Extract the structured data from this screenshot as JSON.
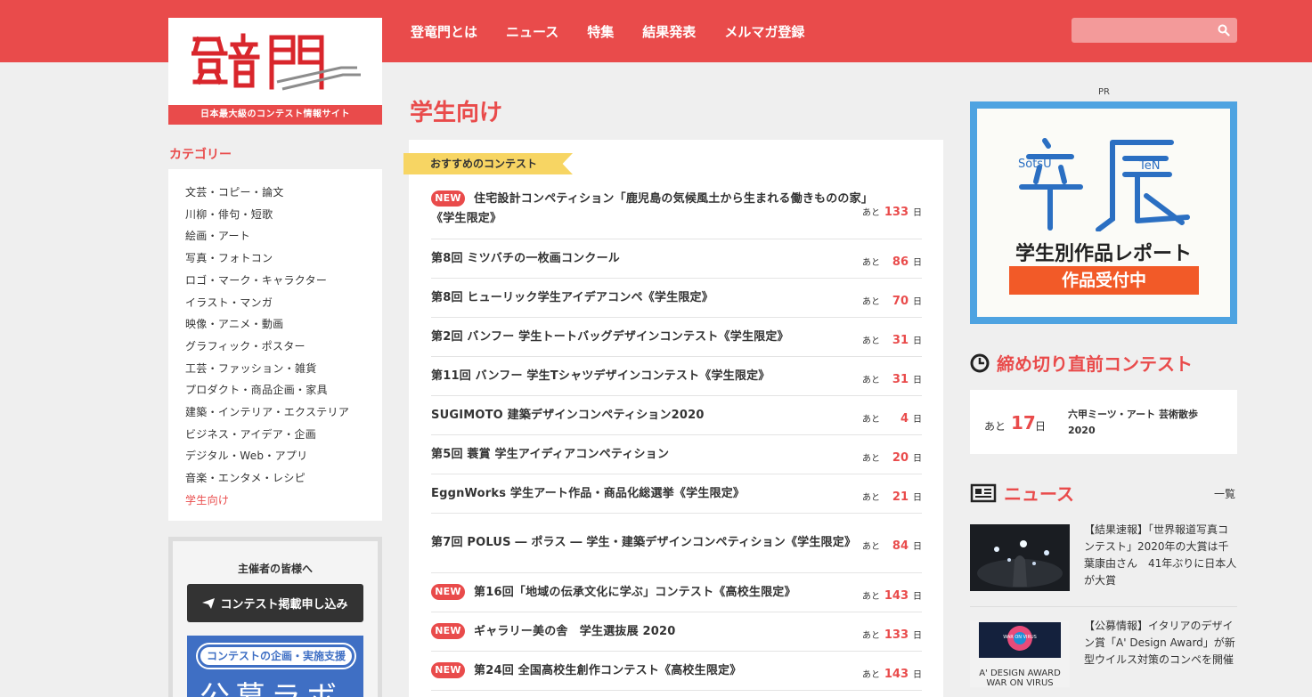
{
  "header": {
    "logo_text": "登竜門",
    "tagline": "日本最大級のコンテスト情報サイト",
    "nav": [
      "登竜門とは",
      "ニュース",
      "特集",
      "結果発表",
      "メルマガ登録"
    ],
    "search_placeholder": ""
  },
  "sidebar": {
    "category_heading": "カテゴリー",
    "categories": [
      "文芸・コピー・論文",
      "川柳・俳句・短歌",
      "絵画・アート",
      "写真・フォトコン",
      "ロゴ・マーク・キャラクター",
      "イラスト・マンガ",
      "映像・アニメ・動画",
      "グラフィック・ポスター",
      "工芸・ファッション・雑貨",
      "プロダクト・商品企画・家具",
      "建築・インテリア・エクステリア",
      "ビジネス・アイデア・企画",
      "デジタル・Web・アプリ",
      "音楽・エンタメ・レシピ",
      "学生向け"
    ],
    "active_category": "学生向け",
    "organizer_title": "主催者の皆様へ",
    "organizer_button": "コンテスト掲載申し込み",
    "lab_banner_pill": "コンテストの企画・実施支援",
    "lab_banner_big": "公募ラボ"
  },
  "main": {
    "page_title": "学生向け",
    "ribbon": "おすすめのコンテスト",
    "new_label": "NEW",
    "ato_label": "あと",
    "nichi_label": "日",
    "contests": [
      {
        "new": true,
        "title": "住宅設計コンペティション「鹿児島の気候風土から生まれる働きものの家」《学生限定》",
        "days": "133"
      },
      {
        "new": false,
        "title": "第8回 ミツバチの一枚画コンクール",
        "days": "86"
      },
      {
        "new": false,
        "title": "第8回 ヒューリック学生アイデアコンペ《学生限定》",
        "days": "70"
      },
      {
        "new": false,
        "title": "第2回 バンフー 学生トートバッグデザインコンテスト《学生限定》",
        "days": "31"
      },
      {
        "new": false,
        "title": "第11回 バンフー 学生Tシャツデザインコンテスト《学生限定》",
        "days": "31"
      },
      {
        "new": false,
        "title": "SUGIMOTO 建築デザインコンペティション2020",
        "days": "4"
      },
      {
        "new": false,
        "title": "第5回 蓑賞 学生アイディアコンペティション",
        "days": "20"
      },
      {
        "new": false,
        "title": "EggnWorks 学生アート作品・商品化総選挙《学生限定》",
        "days": "21"
      },
      {
        "new": false,
        "title": "第7回 POLUS ― ポラス ― 学生・建築デザインコンペティション《学生限定》",
        "days": "84"
      },
      {
        "new": true,
        "title": "第16回「地域の伝承文化に学ぶ」コンテスト《高校生限定》",
        "days": "143"
      },
      {
        "new": true,
        "title": "ギャラリー美の舎　学生選抜展 2020",
        "days": "133"
      },
      {
        "new": true,
        "title": "第24回 全国高校生創作コンテスト《高校生限定》",
        "days": "143"
      }
    ]
  },
  "right": {
    "pr_label": "PR",
    "ad": {
      "sotsu_label": "SotsU",
      "ten_label": "TeN",
      "report": "学生別作品レポート",
      "accept": "作品受付中"
    },
    "deadline_heading": "締め切り直前コンテスト",
    "deadline": {
      "ato": "あと",
      "days": "17",
      "nichi": "日",
      "name": "六甲ミーツ・アート 芸術散歩 2020"
    },
    "news_heading": "ニュース",
    "news_all": "一覧",
    "news": [
      {
        "text": "【結果速報】「世界報道写真コンテスト」2020年の大賞は千葉康由さん　41年ぶりに日本人が大賞"
      },
      {
        "text": "【公募情報】イタリアのデザイン賞「A' Design Award」が新型ウイルス対策のコンペを開催",
        "thumb_line1": "A' DESIGN AWARD",
        "thumb_line2": "WAR ON VIRUS"
      }
    ]
  },
  "colors": {
    "brand": "#e94b4b",
    "ribbon": "#f7d563",
    "ad_frame": "#4ea3e1",
    "ad_button": "#f25a28"
  },
  "icons": [
    "search-icon",
    "paper-plane-icon",
    "clock-icon",
    "newspaper-icon"
  ]
}
